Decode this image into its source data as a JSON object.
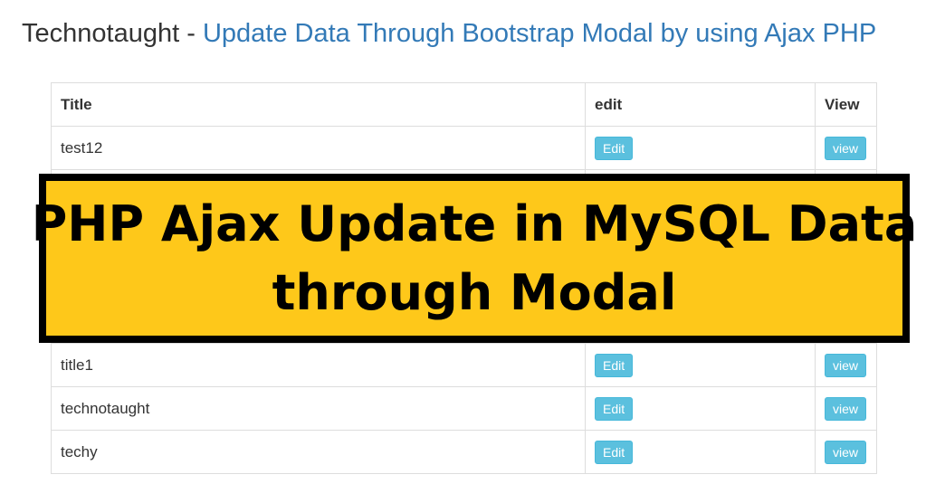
{
  "header": {
    "brand": "Technotaught",
    "separator": "-",
    "link_text": "Update Data Through Bootstrap Modal by using Ajax PHP",
    "link_color": "#337ab7"
  },
  "table": {
    "columns": [
      "Title",
      "edit",
      "View"
    ],
    "rows": [
      {
        "title": "test12",
        "edit_label": "Edit",
        "view_label": "view"
      },
      {
        "title": "title1",
        "edit_label": "Edit",
        "view_label": "view"
      },
      {
        "title": "technotaught",
        "edit_label": "Edit",
        "view_label": "view"
      },
      {
        "title": "techy",
        "edit_label": "Edit",
        "view_label": "view"
      }
    ],
    "button_color": "#5bc0de"
  },
  "banner": {
    "line1": "PHP Ajax Update in MySQL Data",
    "line2": "through Modal",
    "background": "#fec81a",
    "border_color": "#000000"
  }
}
